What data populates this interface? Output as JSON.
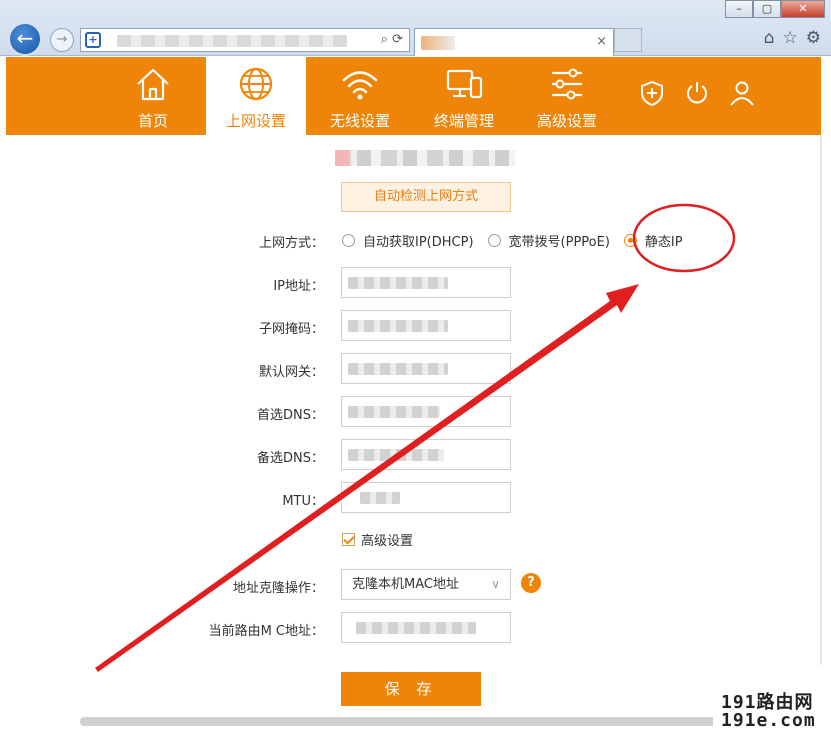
{
  "browser": {
    "window_buttons": [
      "–",
      "▢",
      "✕"
    ],
    "tab_close": "×"
  },
  "nav": {
    "items": [
      {
        "label": "首页",
        "icon": "home-icon"
      },
      {
        "label": "上网设置",
        "icon": "globe-icon"
      },
      {
        "label": "无线设置",
        "icon": "wifi-icon"
      },
      {
        "label": "终端管理",
        "icon": "devices-icon"
      },
      {
        "label": "高级设置",
        "icon": "sliders-icon"
      }
    ],
    "active_index": 1,
    "right_icons": [
      "shield-icon",
      "power-icon",
      "user-icon"
    ]
  },
  "form": {
    "detect_button": "自动检测上网方式",
    "mode_label": "上网方式：",
    "modes": [
      {
        "label": "自动获取IP(DHCP)",
        "selected": false
      },
      {
        "label": "宽带拨号(PPPoE)",
        "selected": false
      },
      {
        "label": "静态IP",
        "selected": true
      }
    ],
    "fields": [
      {
        "label": "IP地址：",
        "masked": true
      },
      {
        "label": "子网掩码：",
        "masked": true
      },
      {
        "label": "默认网关：",
        "masked": true
      },
      {
        "label": "首选DNS：",
        "masked": true
      },
      {
        "label": "备选DNS：",
        "masked": true
      },
      {
        "label": "MTU：",
        "masked": true
      }
    ],
    "advanced_checkbox": "高级设置",
    "advanced_checked": true,
    "mac_clone_label": "地址克隆操作：",
    "mac_clone_value": "克隆本机MAC地址",
    "current_mac_label": "当前路由M  C地址：",
    "help": "?",
    "save_button": "保 存"
  },
  "watermark": {
    "line1": "191路由网",
    "line2": "191e.com"
  },
  "colors": {
    "brand": "#ef8508",
    "annotation": "#e02020"
  }
}
